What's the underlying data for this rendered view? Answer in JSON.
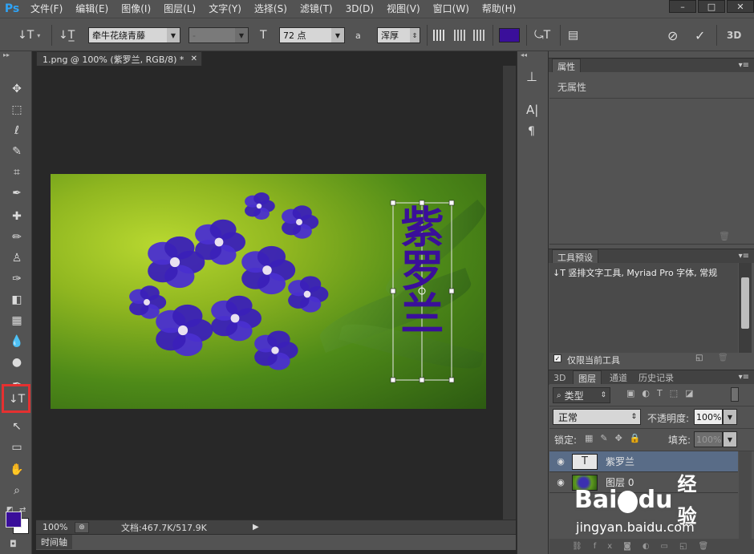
{
  "app": {
    "logo": "Ps"
  },
  "menu": [
    "文件(F)",
    "编辑(E)",
    "图像(I)",
    "图层(L)",
    "文字(Y)",
    "选择(S)",
    "滤镜(T)",
    "3D(D)",
    "视图(V)",
    "窗口(W)",
    "帮助(H)"
  ],
  "window_controls": [
    "–",
    "□",
    "✕"
  ],
  "options_bar": {
    "tool_icon": "↓T",
    "orient_icon": "↓T̲",
    "font_family": "牵牛花绕青藤",
    "font_style": "-",
    "size_icon": "T",
    "font_size": "72 点",
    "aa_icon": "a",
    "antialias": "浑厚",
    "text_color": "#3a0f9a",
    "warp_icon": "⤿T",
    "panels_icon": "▤",
    "cancel_icon": "⊘",
    "commit_icon": "✓",
    "threed_label": "3D"
  },
  "toolbar": {
    "tools": [
      "move",
      "marquee",
      "lasso",
      "quick-select",
      "crop",
      "eyedropper",
      "healing",
      "brush",
      "stamp",
      "history-brush",
      "eraser",
      "gradient",
      "blur",
      "dodge",
      "pen",
      "vertical-type",
      "path-select",
      "rectangle",
      "hand",
      "zoom"
    ],
    "glyphs": [
      "✥",
      "⬚",
      "ℓ",
      "✎",
      "⌗",
      "✒",
      "✚",
      "✏",
      "♙",
      "✑",
      "◧",
      "▦",
      "💧",
      "●",
      "✒",
      "↓T",
      "↖",
      "▭",
      "✋",
      "⌕"
    ],
    "fg_color": "#3a0f9a",
    "bg_color": "#ffffff"
  },
  "document": {
    "tab_label": "1.png @ 100% (紫罗兰, RGB/8) *",
    "tab_close": "✕",
    "vertical_text": "紫罗兰",
    "vertical_text_color": "#3a0f9a",
    "zoom": "100%",
    "doc_info": "文档:467.7K/517.9K"
  },
  "timeline": {
    "label": "时间轴"
  },
  "panels": {
    "properties": {
      "tab": "属性",
      "content": "无属性"
    },
    "tool_presets": {
      "tab": "工具预设",
      "item": "↓T 竖排文字工具, Myriad Pro 字体, 常规",
      "checkbox_label": "仅限当前工具"
    },
    "layers": {
      "tabs": [
        "3D",
        "图层",
        "通道",
        "历史记录"
      ],
      "active_tab": "图层",
      "filter": "类型",
      "blend_mode": "正常",
      "opacity_label": "不透明度:",
      "opacity": "100%",
      "lock_label": "锁定:",
      "fill_label": "填充:",
      "fill": "100%",
      "items": [
        {
          "name": "紫罗兰",
          "type": "text",
          "thumb": "T"
        },
        {
          "name": "图层 0",
          "type": "image",
          "thumb": ""
        }
      ]
    }
  },
  "watermark": {
    "brand": "Bai",
    "paw": "du",
    "brand2": "经验",
    "url": "jingyan.baidu.com"
  }
}
